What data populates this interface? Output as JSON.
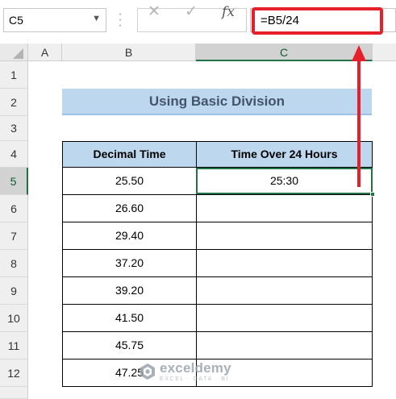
{
  "formula_bar": {
    "name_box": "C5",
    "name_box_icon": "chevron-down-icon",
    "cancel_icon": "✕",
    "enter_icon": "✓",
    "function_icon": "fx",
    "formula": "=B5/24"
  },
  "columns": [
    "A",
    "B",
    "C"
  ],
  "rows": [
    "1",
    "2",
    "3",
    "4",
    "5",
    "6",
    "7",
    "8",
    "9",
    "10",
    "11",
    "12"
  ],
  "active_cell": {
    "column": "C",
    "row": "5"
  },
  "sheet": {
    "title": "Using Basic Division",
    "headers": [
      "Decimal Time",
      "Time Over 24 Hours"
    ],
    "decimal_times": [
      "25.50",
      "26.60",
      "29.40",
      "37.20",
      "39.20",
      "41.50",
      "45.75",
      "47.25"
    ],
    "time_over_24": [
      "25:30",
      "",
      "",
      "",
      "",
      "",
      "",
      ""
    ]
  },
  "watermark": {
    "name": "exceldemy",
    "tagline": "EXCEL · DATA · BI"
  },
  "colors": {
    "accent_green": "#217346",
    "header_fill": "#bdd7ee",
    "highlight_red": "#e5202a"
  }
}
